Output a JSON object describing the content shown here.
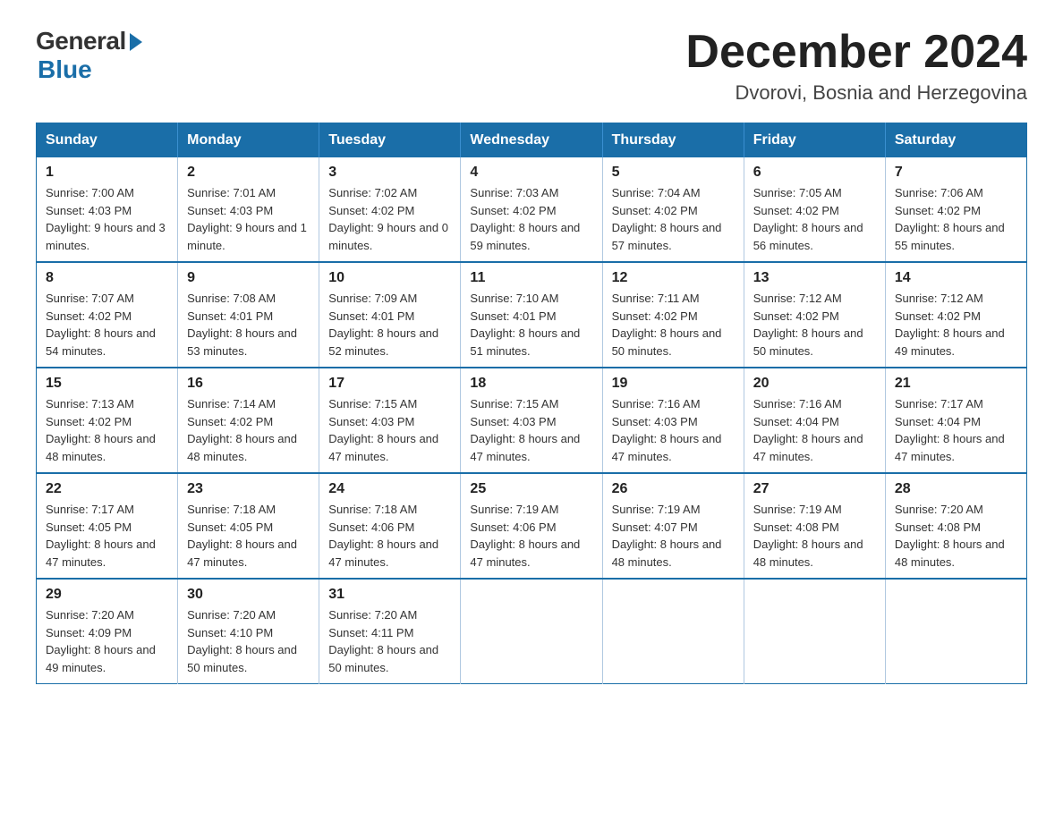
{
  "header": {
    "logo_general": "General",
    "logo_blue": "Blue",
    "month_title": "December 2024",
    "location": "Dvorovi, Bosnia and Herzegovina"
  },
  "days_of_week": [
    "Sunday",
    "Monday",
    "Tuesday",
    "Wednesday",
    "Thursday",
    "Friday",
    "Saturday"
  ],
  "weeks": [
    [
      {
        "day": "1",
        "sunrise": "7:00 AM",
        "sunset": "4:03 PM",
        "daylight": "9 hours and 3 minutes."
      },
      {
        "day": "2",
        "sunrise": "7:01 AM",
        "sunset": "4:03 PM",
        "daylight": "9 hours and 1 minute."
      },
      {
        "day": "3",
        "sunrise": "7:02 AM",
        "sunset": "4:02 PM",
        "daylight": "9 hours and 0 minutes."
      },
      {
        "day": "4",
        "sunrise": "7:03 AM",
        "sunset": "4:02 PM",
        "daylight": "8 hours and 59 minutes."
      },
      {
        "day": "5",
        "sunrise": "7:04 AM",
        "sunset": "4:02 PM",
        "daylight": "8 hours and 57 minutes."
      },
      {
        "day": "6",
        "sunrise": "7:05 AM",
        "sunset": "4:02 PM",
        "daylight": "8 hours and 56 minutes."
      },
      {
        "day": "7",
        "sunrise": "7:06 AM",
        "sunset": "4:02 PM",
        "daylight": "8 hours and 55 minutes."
      }
    ],
    [
      {
        "day": "8",
        "sunrise": "7:07 AM",
        "sunset": "4:02 PM",
        "daylight": "8 hours and 54 minutes."
      },
      {
        "day": "9",
        "sunrise": "7:08 AM",
        "sunset": "4:01 PM",
        "daylight": "8 hours and 53 minutes."
      },
      {
        "day": "10",
        "sunrise": "7:09 AM",
        "sunset": "4:01 PM",
        "daylight": "8 hours and 52 minutes."
      },
      {
        "day": "11",
        "sunrise": "7:10 AM",
        "sunset": "4:01 PM",
        "daylight": "8 hours and 51 minutes."
      },
      {
        "day": "12",
        "sunrise": "7:11 AM",
        "sunset": "4:02 PM",
        "daylight": "8 hours and 50 minutes."
      },
      {
        "day": "13",
        "sunrise": "7:12 AM",
        "sunset": "4:02 PM",
        "daylight": "8 hours and 50 minutes."
      },
      {
        "day": "14",
        "sunrise": "7:12 AM",
        "sunset": "4:02 PM",
        "daylight": "8 hours and 49 minutes."
      }
    ],
    [
      {
        "day": "15",
        "sunrise": "7:13 AM",
        "sunset": "4:02 PM",
        "daylight": "8 hours and 48 minutes."
      },
      {
        "day": "16",
        "sunrise": "7:14 AM",
        "sunset": "4:02 PM",
        "daylight": "8 hours and 48 minutes."
      },
      {
        "day": "17",
        "sunrise": "7:15 AM",
        "sunset": "4:03 PM",
        "daylight": "8 hours and 47 minutes."
      },
      {
        "day": "18",
        "sunrise": "7:15 AM",
        "sunset": "4:03 PM",
        "daylight": "8 hours and 47 minutes."
      },
      {
        "day": "19",
        "sunrise": "7:16 AM",
        "sunset": "4:03 PM",
        "daylight": "8 hours and 47 minutes."
      },
      {
        "day": "20",
        "sunrise": "7:16 AM",
        "sunset": "4:04 PM",
        "daylight": "8 hours and 47 minutes."
      },
      {
        "day": "21",
        "sunrise": "7:17 AM",
        "sunset": "4:04 PM",
        "daylight": "8 hours and 47 minutes."
      }
    ],
    [
      {
        "day": "22",
        "sunrise": "7:17 AM",
        "sunset": "4:05 PM",
        "daylight": "8 hours and 47 minutes."
      },
      {
        "day": "23",
        "sunrise": "7:18 AM",
        "sunset": "4:05 PM",
        "daylight": "8 hours and 47 minutes."
      },
      {
        "day": "24",
        "sunrise": "7:18 AM",
        "sunset": "4:06 PM",
        "daylight": "8 hours and 47 minutes."
      },
      {
        "day": "25",
        "sunrise": "7:19 AM",
        "sunset": "4:06 PM",
        "daylight": "8 hours and 47 minutes."
      },
      {
        "day": "26",
        "sunrise": "7:19 AM",
        "sunset": "4:07 PM",
        "daylight": "8 hours and 48 minutes."
      },
      {
        "day": "27",
        "sunrise": "7:19 AM",
        "sunset": "4:08 PM",
        "daylight": "8 hours and 48 minutes."
      },
      {
        "day": "28",
        "sunrise": "7:20 AM",
        "sunset": "4:08 PM",
        "daylight": "8 hours and 48 minutes."
      }
    ],
    [
      {
        "day": "29",
        "sunrise": "7:20 AM",
        "sunset": "4:09 PM",
        "daylight": "8 hours and 49 minutes."
      },
      {
        "day": "30",
        "sunrise": "7:20 AM",
        "sunset": "4:10 PM",
        "daylight": "8 hours and 50 minutes."
      },
      {
        "day": "31",
        "sunrise": "7:20 AM",
        "sunset": "4:11 PM",
        "daylight": "8 hours and 50 minutes."
      },
      null,
      null,
      null,
      null
    ]
  ]
}
